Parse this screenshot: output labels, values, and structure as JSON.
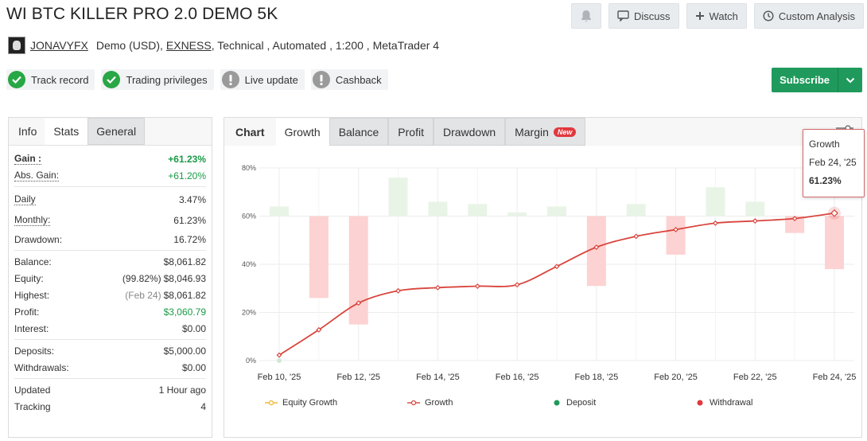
{
  "title": "WI BTC KILLER PRO 2.0 DEMO 5K",
  "actions": {
    "bell_icon": "bell-icon",
    "discuss": "Discuss",
    "watch": "Watch",
    "custom_analysis": "Custom Analysis"
  },
  "meta": {
    "user": "JONAVYFX",
    "account": "Demo (USD),",
    "broker": "EXNESS",
    "rest": ", Technical , Automated , 1:200 , MetaTrader 4"
  },
  "badges": [
    {
      "label": "Track record",
      "status": "check"
    },
    {
      "label": "Trading privileges",
      "status": "check"
    },
    {
      "label": "Live update",
      "status": "info"
    },
    {
      "label": "Cashback",
      "status": "info"
    }
  ],
  "subscribe": "Subscribe",
  "left_tabs": {
    "info": "Info",
    "stats": "Stats",
    "general": "General"
  },
  "stats": {
    "gain_label": "Gain :",
    "gain": "+61.23%",
    "abs_gain_label": "Abs. Gain:",
    "abs_gain": "+61.20%",
    "daily_label": "Daily",
    "daily": "3.47%",
    "monthly_label": "Monthly:",
    "monthly": "61.23%",
    "drawdown_label": "Drawdown:",
    "drawdown": "16.72%",
    "balance_label": "Balance:",
    "balance": "$8,061.82",
    "equity_label": "Equity:",
    "equity_pct": "(99.82%)",
    "equity": "$8,046.93",
    "highest_label": "Highest:",
    "highest_date": "(Feb 24)",
    "highest": "$8,061.82",
    "profit_label": "Profit:",
    "profit": "$3,060.79",
    "interest_label": "Interest:",
    "interest": "$0.00",
    "deposits_label": "Deposits:",
    "deposits": "$5,000.00",
    "withdrawals_label": "Withdrawals:",
    "withdrawals": "$0.00",
    "updated_label": "Updated",
    "updated": "1 Hour ago",
    "tracking_label": "Tracking",
    "tracking": "4"
  },
  "chart_tabs": {
    "label": "Chart",
    "growth": "Growth",
    "balance": "Balance",
    "profit": "Profit",
    "drawdown": "Drawdown",
    "margin": "Margin",
    "new_badge": "New"
  },
  "tooltip": {
    "series": "Growth",
    "date": "Feb 24, '25",
    "value": "61.23%"
  },
  "legend": {
    "equity_growth": "Equity Growth",
    "growth": "Growth",
    "deposit": "Deposit",
    "withdrawal": "Withdrawal"
  },
  "colors": {
    "growth_line": "#d9453d",
    "equity_line": "#f0b429",
    "deposit": "#1f9a5c",
    "withdrawal": "#e0383e",
    "bar_pos": "#e8f5e6",
    "bar_neg": "#fdd2d2"
  },
  "chart_data": {
    "type": "line",
    "x": [
      "Feb 10, '25",
      "Feb 11, '25",
      "Feb 12, '25",
      "Feb 13, '25",
      "Feb 14, '25",
      "Feb 15, '25",
      "Feb 16, '25",
      "Feb 17, '25",
      "Feb 18, '25",
      "Feb 19, '25",
      "Feb 20, '25",
      "Feb 21, '25",
      "Feb 22, '25",
      "Feb 23, '25",
      "Feb 24, '25"
    ],
    "xticks": [
      "Feb 10, '25",
      "Feb 12, '25",
      "Feb 14, '25",
      "Feb 16, '25",
      "Feb 18, '25",
      "Feb 20, '25",
      "Feb 22, '25",
      "Feb 24, '25"
    ],
    "yticks": [
      "0%",
      "20%",
      "40%",
      "60%",
      "80%"
    ],
    "ylim": [
      0,
      80
    ],
    "series": [
      {
        "name": "Growth",
        "values": [
          2.3,
          12.8,
          23.9,
          29.0,
          30.3,
          30.9,
          31.5,
          39.1,
          47.1,
          51.6,
          54.4,
          57.1,
          58.0,
          59.0,
          61.23
        ]
      }
    ],
    "bars_pct": [
      {
        "x": 0,
        "value": 4
      },
      {
        "x": 1,
        "value": -34
      },
      {
        "x": 2,
        "value": -45
      },
      {
        "x": 3,
        "value": 16
      },
      {
        "x": 4,
        "value": 6
      },
      {
        "x": 5,
        "value": 5
      },
      {
        "x": 6,
        "value": 1.5
      },
      {
        "x": 7,
        "value": 4
      },
      {
        "x": 8,
        "value": -29
      },
      {
        "x": 9,
        "value": 5
      },
      {
        "x": 10,
        "value": -16
      },
      {
        "x": 11,
        "value": 12
      },
      {
        "x": 12,
        "value": 6
      },
      {
        "x": 13,
        "value": -7
      },
      {
        "x": 14,
        "value": -22
      }
    ],
    "deposit_x": 0,
    "grid": true,
    "legend_position": "bottom"
  }
}
